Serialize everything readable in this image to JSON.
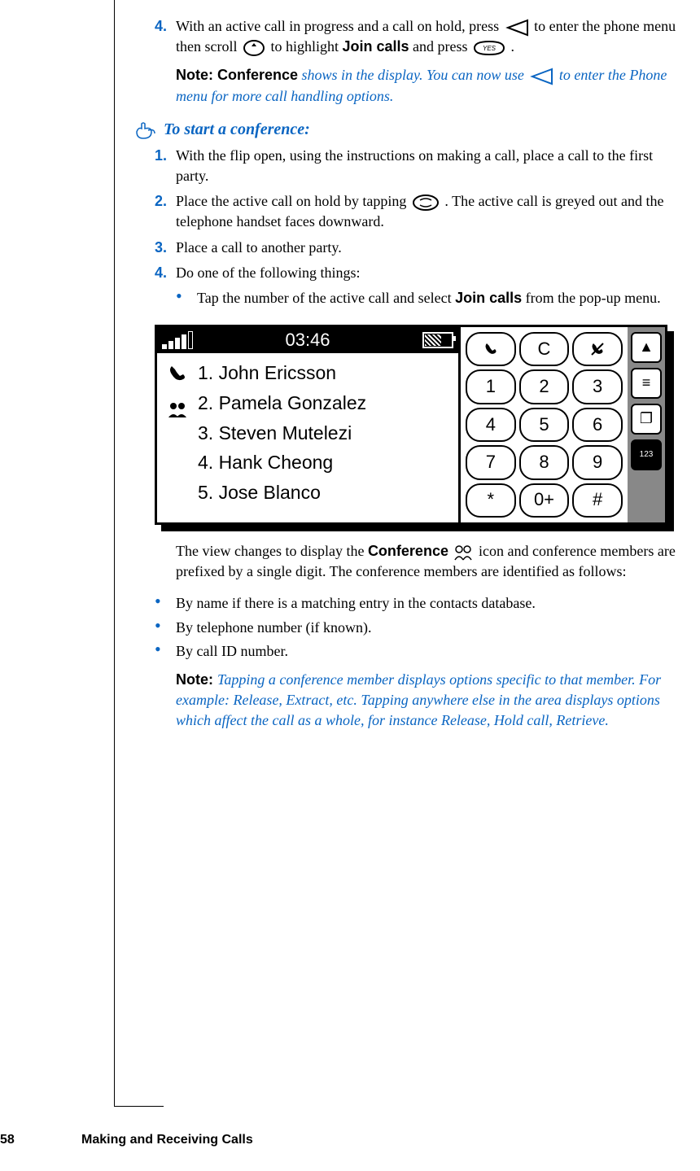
{
  "step4_top": {
    "num": "4.",
    "text_a": "With an active call in progress and a call on hold, press ",
    "text_b": " to enter the phone menu then scroll ",
    "text_c": " to highlight ",
    "join_label": "Join calls",
    "text_d": " and press ",
    "text_e": "."
  },
  "note1": {
    "label": "Note:  ",
    "bold": "Conference",
    "text_a": " shows in the display. You can now use ",
    "text_b": " to enter the Phone menu for more call handling options."
  },
  "heading": "To start a conference:",
  "steps": {
    "s1": {
      "num": "1.",
      "text": "With the flip open, using the instructions on making a call, place a call to the first party."
    },
    "s2": {
      "num": "2.",
      "text_a": "Place the active call on hold by tapping ",
      "text_b": ". The active call is greyed out and the telephone handset faces downward."
    },
    "s3": {
      "num": "3.",
      "text": "Place a call to another party."
    },
    "s4": {
      "num": "4.",
      "text": "Do one of the following things:"
    }
  },
  "sub_bullet": {
    "text_a": "Tap the number of the active call and select ",
    "join_label": "Join calls",
    "text_b": " from the pop-up menu."
  },
  "phone": {
    "time": "03:46",
    "list": [
      "1. John Ericsson",
      "2. Pamela Gonzalez",
      "3. Steven Mutelezi",
      "4. Hank Cheong",
      "5. Jose Blanco"
    ],
    "keys": [
      "",
      "C",
      "",
      "1",
      "2",
      "3",
      "4",
      "5",
      "6",
      "7",
      "8",
      "9",
      "*",
      "0+",
      "#"
    ]
  },
  "after_phone": {
    "text_a": "The view changes to display the ",
    "conf_label": "Conference",
    "text_b": " icon and conference members are prefixed by a single digit. The conference members are identified as follows:"
  },
  "bullets": [
    "By name if there is a matching entry in the contacts database.",
    "By telephone number (if known).",
    "By call ID number."
  ],
  "note2": {
    "label": "Note:  ",
    "text": "Tapping a conference member displays options specific to that member. For example: Release, Extract, etc. Tapping anywhere else in the area displays options which affect the call as a whole, for instance Release, Hold call, Retrieve."
  },
  "footer": {
    "page": "58",
    "section": "Making and Receiving Calls"
  }
}
